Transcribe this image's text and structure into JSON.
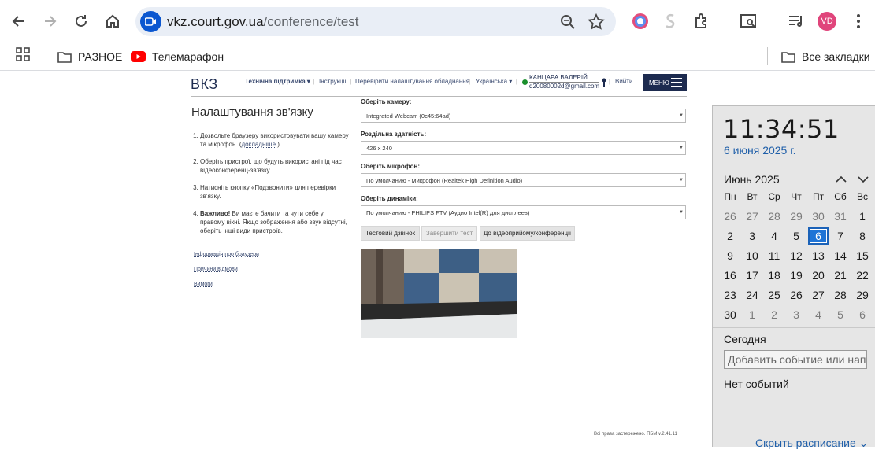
{
  "browser": {
    "url_domain": "vkz.court.gov.ua",
    "url_path": "/conference/test",
    "avatar_initials": "VD",
    "bookmarks": [
      {
        "label": "РАЗНОЕ",
        "icon": "folder-icon"
      },
      {
        "label": "Телемарафон",
        "icon": "youtube-icon"
      }
    ],
    "all_bookmarks_label": "Все закладки"
  },
  "header": {
    "logo": "ВКЗ",
    "nav": {
      "support": "Технічна підтримка ▾",
      "instructions": "Інструкції",
      "check_equipment": "Перевірити налаштування обладнання",
      "language": "Українська ▾"
    },
    "user_name": "КАНЦАРА ВАЛЕРІЙ",
    "user_email": "d20080002d@gmail.com",
    "logout": "Вийти",
    "menu": "МЕНЮ"
  },
  "settings": {
    "title": "Налаштування зв'язку",
    "steps": [
      {
        "text": "Дозвольте браузеру використовувати вашу камеру та мікрофон. (",
        "link": "докладніше",
        "after": ")"
      },
      {
        "text": "Оберіть пристрої, що будуть використані під час відеоконференц-зв'язку."
      },
      {
        "text": "Натисніть кнопку «Подзвонити» для перевірки зв'язку."
      },
      {
        "bold": "Важливо!",
        "text": " Ви маєте бачити та чути себе у правому вікні. Якщо зображення або звук відсутні, оберіть інші види пристроїв."
      }
    ],
    "links": [
      "Інформація про браузери",
      "Причини відмови",
      "Вимоги"
    ]
  },
  "devices": {
    "camera_label": "Оберіть камеру:",
    "camera_value": "Integrated Webcam (0c45:64ad)",
    "resolution_label": "Роздільна здатність:",
    "resolution_value": "426 x 240",
    "mic_label": "Оберіть мікрофон:",
    "mic_value": "По умолчанию - Микрофон (Realtek High Definition Audio)",
    "speakers_label": "Оберіть динаміки:",
    "speakers_value": "По умолчанию - PHILIPS FTV (Аудио Intel(R) для дисплеев)",
    "btn_test": "Тестовий дзвінок",
    "btn_end": "Завершити тест",
    "btn_conference": "До відеоприйому/конференції"
  },
  "footer": "Всі права застережено. ПБМ v.2.41.11",
  "calendar": {
    "time": "11:34:51",
    "date": "6 июня 2025 г.",
    "month": "Июнь 2025",
    "weekdays": [
      "Пн",
      "Вт",
      "Ср",
      "Чт",
      "Пт",
      "Сб",
      "Вс"
    ],
    "weeks": [
      [
        "26",
        "27",
        "28",
        "29",
        "30",
        "31",
        "1"
      ],
      [
        "2",
        "3",
        "4",
        "5",
        "6",
        "7",
        "8"
      ],
      [
        "9",
        "10",
        "11",
        "12",
        "13",
        "14",
        "15"
      ],
      [
        "16",
        "17",
        "18",
        "19",
        "20",
        "21",
        "22"
      ],
      [
        "23",
        "24",
        "25",
        "26",
        "27",
        "28",
        "29"
      ],
      [
        "30",
        "1",
        "2",
        "3",
        "4",
        "5",
        "6"
      ]
    ],
    "today_label": "Сегодня",
    "event_placeholder": "Добавить событие или напо",
    "no_events": "Нет событий",
    "hide_schedule": "Скрыть расписание"
  }
}
